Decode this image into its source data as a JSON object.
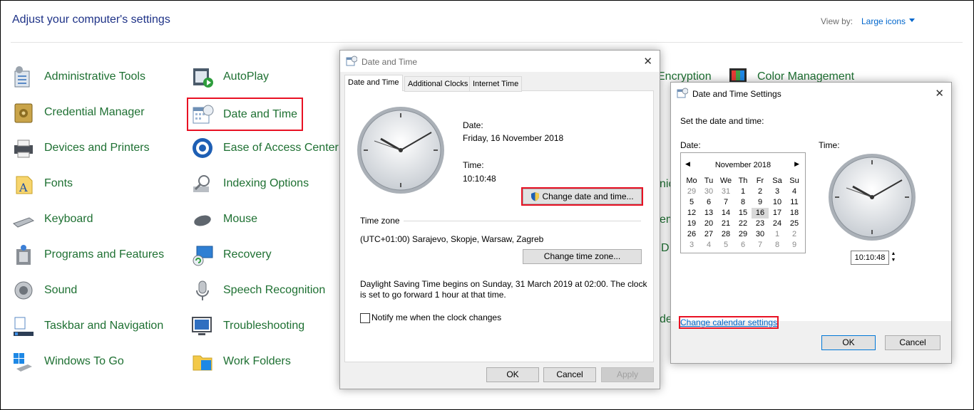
{
  "control_panel": {
    "title": "Adjust your computer's settings",
    "view_by_label": "View by:",
    "view_by_value": "Large icons",
    "col1": [
      "Administrative Tools",
      "Credential Manager",
      "Devices and Printers",
      "Fonts",
      "Keyboard",
      "Programs and Features",
      "Sound",
      "Taskbar and Navigation",
      "Windows To Go"
    ],
    "col2": [
      "AutoPlay",
      "Date and Time",
      "Ease of Access Center",
      "Indexing Options",
      "Mouse",
      "Recovery",
      "Speech Recognition",
      "Troubleshooting",
      "Work Folders"
    ],
    "col3_partial": [
      "Encryption"
    ],
    "col4_partial": [
      "Color Management"
    ]
  },
  "date_time_dialog": {
    "title": "Date and Time",
    "tabs": [
      "Date and Time",
      "Additional Clocks",
      "Internet Time"
    ],
    "date_label": "Date:",
    "date_value": "Friday, 16 November 2018",
    "time_label": "Time:",
    "time_value": "10:10:48",
    "change_datetime_btn": "Change date and time...",
    "timezone_label": "Time zone",
    "timezone_value": "(UTC+01:00) Sarajevo, Skopje, Warsaw, Zagreb",
    "change_timezone_btn": "Change time zone...",
    "dst_line1": "Daylight Saving Time begins on Sunday, 31 March 2019 at 02:00. The clock",
    "dst_line2": "is set to go forward 1 hour at that time.",
    "notify_label": "Notify me when the clock changes",
    "ok": "OK",
    "cancel": "Cancel",
    "apply": "Apply"
  },
  "settings_dialog": {
    "title": "Date and Time Settings",
    "instruction": "Set the date and time:",
    "date_label": "Date:",
    "time_label": "Time:",
    "month": "November 2018",
    "weekdays": [
      "Mo",
      "Tu",
      "We",
      "Th",
      "Fr",
      "Sa",
      "Su"
    ],
    "days": [
      "29",
      "30",
      "31",
      "1",
      "2",
      "3",
      "4",
      "5",
      "6",
      "7",
      "8",
      "9",
      "10",
      "11",
      "12",
      "13",
      "14",
      "15",
      "16",
      "17",
      "18",
      "19",
      "20",
      "21",
      "22",
      "23",
      "24",
      "25",
      "26",
      "27",
      "28",
      "29",
      "30",
      "1",
      "2",
      "3",
      "4",
      "5",
      "6",
      "7",
      "8",
      "9"
    ],
    "time_value": "10:10:48",
    "change_calendar_link": "Change calendar settings",
    "ok": "OK",
    "cancel": "Cancel"
  },
  "partial_labels": [
    "nic",
    "em",
    "D",
    "de"
  ],
  "colors": {
    "link_green": "#1e7032",
    "title_blue": "#1e3287",
    "highlight_red": "#e81123"
  }
}
